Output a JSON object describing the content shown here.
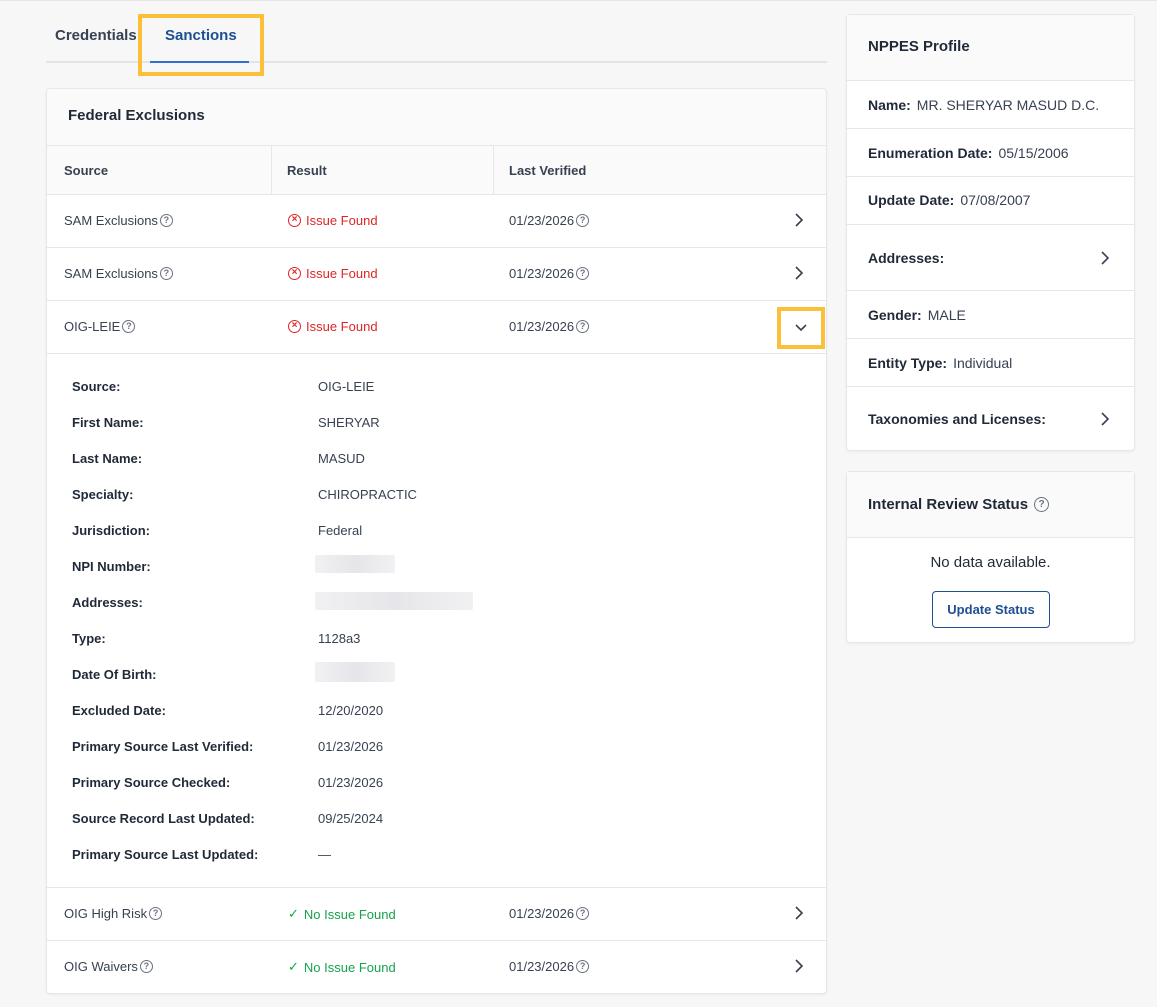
{
  "tabs": [
    {
      "label": "Credentials"
    },
    {
      "label": "Sanctions"
    }
  ],
  "federal_exclusions": {
    "title": "Federal Exclusions",
    "columns": [
      "Source",
      "Result",
      "Last Verified"
    ],
    "rows": [
      {
        "source": "SAM Exclusions",
        "result": "Issue Found",
        "verified": "01/23/2026",
        "status": "issue"
      },
      {
        "source": "SAM Exclusions",
        "result": "Issue Found",
        "verified": "01/23/2026",
        "status": "issue"
      },
      {
        "source": "OIG-LEIE",
        "result": "Issue Found",
        "verified": "01/23/2026",
        "status": "issue",
        "expanded": true
      },
      {
        "source": "OIG High Risk",
        "result": "No Issue Found",
        "verified": "01/23/2026",
        "status": "ok"
      },
      {
        "source": "OIG Waivers",
        "result": "No Issue Found",
        "verified": "01/23/2026",
        "status": "ok"
      }
    ],
    "details": [
      {
        "label": "Source:",
        "value": "OIG-LEIE"
      },
      {
        "label": "First Name:",
        "value": "SHERYAR"
      },
      {
        "label": "Last Name:",
        "value": "MASUD"
      },
      {
        "label": "Specialty:",
        "value": "CHIROPRACTIC"
      },
      {
        "label": "Jurisdiction:",
        "value": "Federal"
      },
      {
        "label": "NPI Number:",
        "value": ""
      },
      {
        "label": "Addresses:",
        "value": ""
      },
      {
        "label": "Type:",
        "value": "1128a3"
      },
      {
        "label": "Date Of Birth:",
        "value": ""
      },
      {
        "label": "Excluded Date:",
        "value": "12/20/2020"
      },
      {
        "label": "Primary Source Last Verified:",
        "value": "01/23/2026"
      },
      {
        "label": "Primary Source Checked:",
        "value": "01/23/2026"
      },
      {
        "label": "Source Record Last Updated:",
        "value": "09/25/2024"
      },
      {
        "label": "Primary Source Last Updated:",
        "value": "—"
      }
    ]
  },
  "nppes": {
    "title": "NPPES Profile",
    "name_label": "Name:",
    "name": "MR. SHERYAR MASUD D.C.",
    "enum_label": "Enumeration Date:",
    "enum_date": "05/15/2006",
    "update_label": "Update Date:",
    "update_date": "07/08/2007",
    "addresses_label": "Addresses:",
    "gender_label": "Gender:",
    "gender": "MALE",
    "entity_label": "Entity Type:",
    "entity": "Individual",
    "taxonomies_label": "Taxonomies and Licenses:"
  },
  "review": {
    "title": "Internal Review Status",
    "empty": "No data available.",
    "button": "Update Status"
  },
  "colors": {
    "accent": "#1d4f91",
    "issue": "#dc2626",
    "ok": "#16a34a",
    "highlight": "#fbbf38"
  },
  "icons": {
    "help": "question-circle-icon",
    "issue": "x-circle-icon",
    "ok": "check-icon",
    "chevron": "chevron-right-icon",
    "expand": "chevron-down-icon"
  }
}
